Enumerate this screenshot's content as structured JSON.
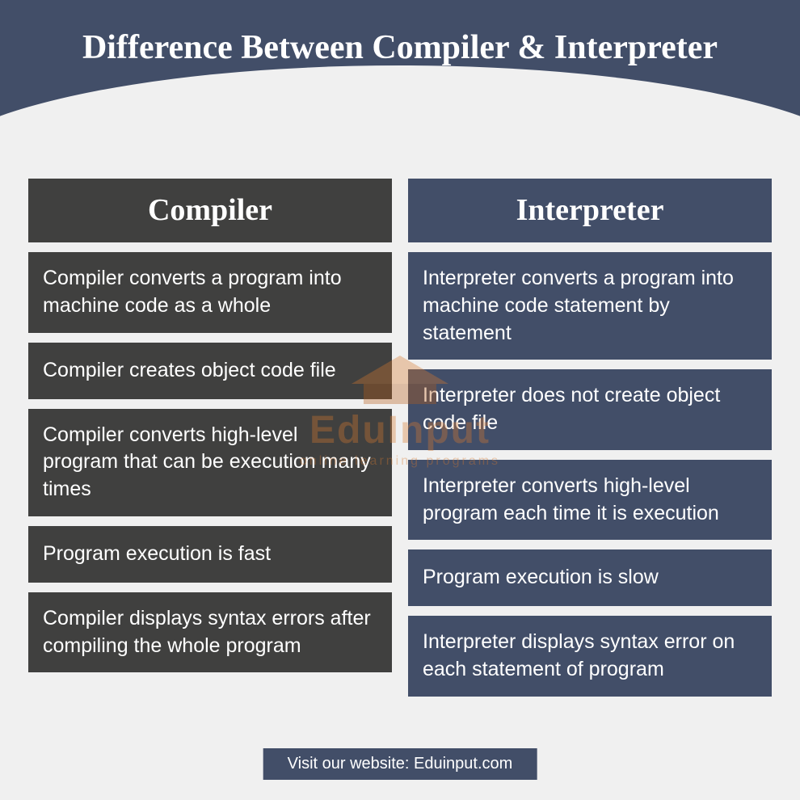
{
  "title": "Difference Between Compiler & Interpreter",
  "columns": {
    "left": {
      "header": "Compiler",
      "rows": [
        "Compiler converts a program into machine code as a whole",
        "Compiler creates object code file",
        "Compiler converts high-level program that can be execution many times",
        "Program execution is fast",
        "Compiler displays syntax errors after compiling the whole program"
      ]
    },
    "right": {
      "header": "Interpreter",
      "rows": [
        "Interpreter converts a program into machine code statement by statement",
        "Interpreter does not create object code file",
        "Interpreter converts high-level program each time it is execution",
        "Program execution is slow",
        "Interpreter displays syntax error on each statement of program"
      ]
    }
  },
  "footer": "Visit our website: Eduinput.com",
  "watermark": {
    "text": "EduInput",
    "sub": "online learning programs"
  },
  "chart_data": {
    "type": "table",
    "title": "Difference Between Compiler & Interpreter",
    "columns": [
      "Compiler",
      "Interpreter"
    ],
    "rows": [
      [
        "Compiler converts a program into machine code as a whole",
        "Interpreter converts a program into machine code statement by statement"
      ],
      [
        "Compiler creates object code file",
        "Interpreter does not create object code file"
      ],
      [
        "Compiler converts high-level program that can be execution many times",
        "Interpreter converts high-level program each time it is execution"
      ],
      [
        "Program execution is fast",
        "Program execution is slow"
      ],
      [
        "Compiler displays syntax errors after compiling the whole program",
        "Interpreter displays syntax error on each statement of program"
      ]
    ]
  }
}
